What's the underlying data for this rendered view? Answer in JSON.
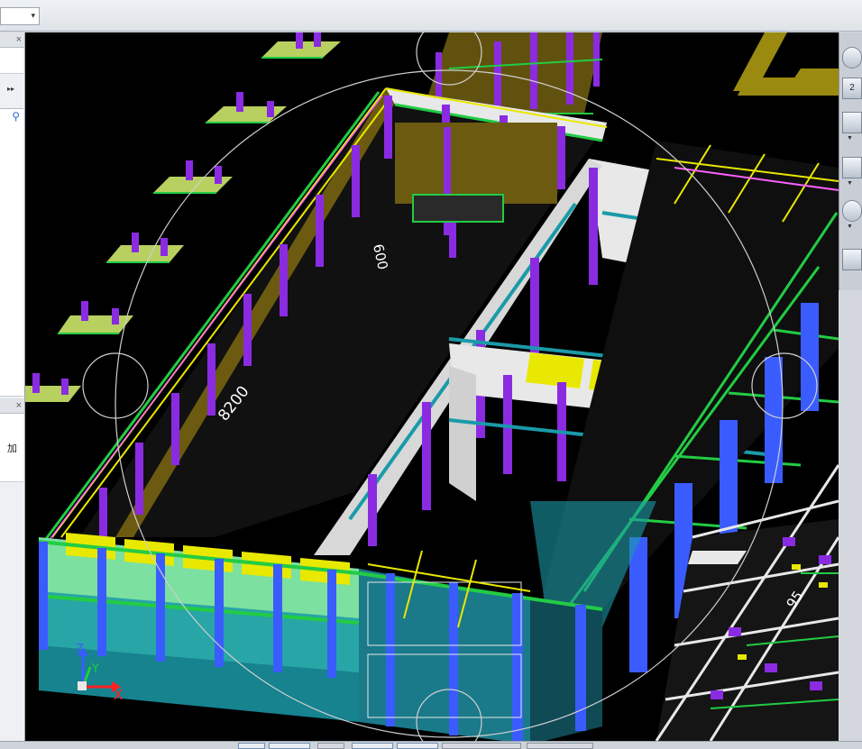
{
  "toolbar": {
    "view_select_value": "",
    "view_select_arrow": "▾"
  },
  "left_panel": {
    "close_glyph": "×",
    "expand_glyph": "▸▸",
    "search_glyph": "⚲",
    "lower_label": "加"
  },
  "viewport": {
    "dimension_labels": [
      "8200",
      "600",
      "95"
    ],
    "axis_labels": {
      "x": "X",
      "y": "Y",
      "z": "Z"
    }
  },
  "right_toolbar": {
    "view_2d_label": "2"
  },
  "colors": {
    "background": "#000000",
    "column": "#8a2be2",
    "wall": "#e8e8e8",
    "beam_green": "#22cc44",
    "beam_yellow": "#e8e800",
    "slab_olive": "#9a8a10",
    "glass": "#7ce0a0",
    "facade_blue": "#3a5cff",
    "facade_cyan": "#1a9aa8"
  }
}
